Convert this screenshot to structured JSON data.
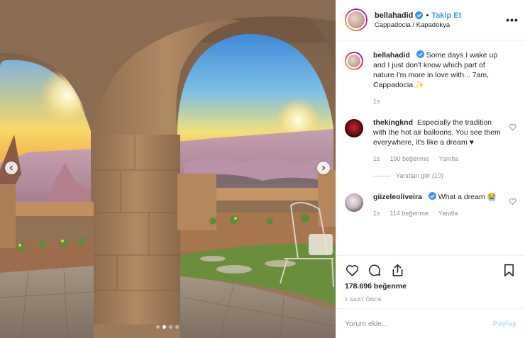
{
  "header": {
    "username": "bellahadid",
    "follow_separator": "•",
    "follow_label": "Takip Et",
    "location": "Cappadocia / Kapadokya",
    "more_label": "•••"
  },
  "carousel": {
    "slides": 4,
    "active_slide": 2
  },
  "caption": {
    "username": "bellahadid",
    "text": "Some days I wake up and I just don't know which part of nature I'm more in love with... 7am, Cappadocia ✨",
    "time": "1s"
  },
  "comments": [
    {
      "username": "thekingknd",
      "text": "Especially the tradition with the hot air balloons. You see them everywhere, it's like a dream ♥",
      "time": "1s",
      "likes": "190 beğenme",
      "reply_label": "Yanıtla",
      "view_replies": "Yanıtları gör (10)"
    },
    {
      "username": "giizeleoliveira",
      "text": "What a dream 😭",
      "time": "1s",
      "likes": "114 beğenme",
      "reply_label": "Yanıtla"
    }
  ],
  "stats": {
    "likes": "178.696 beğenme",
    "time_ago": "1 SAAT ÖNCE"
  },
  "comment_box": {
    "placeholder": "Yorum ekle...",
    "post_label": "Paylaş"
  },
  "colors": {
    "link_blue": "#3897f0",
    "post_disabled": "#b2dffc",
    "verified_blue": "#3897f0",
    "heart_red": "#b1171f"
  },
  "icons": [
    "heart-icon",
    "comment-icon",
    "share-icon",
    "bookmark-icon",
    "verified-badge-icon",
    "more-options-icon",
    "chevron-left-icon",
    "chevron-right-icon"
  ]
}
